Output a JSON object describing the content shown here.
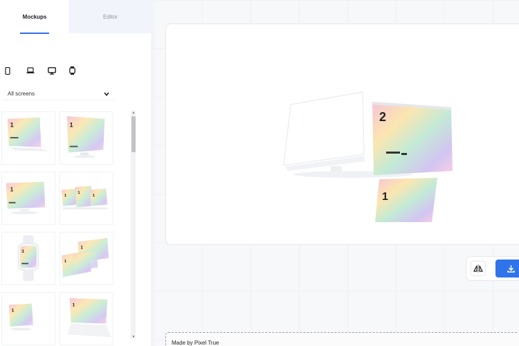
{
  "sidebar": {
    "tabs": [
      {
        "label": "Mockups",
        "active": true
      },
      {
        "label": "Editor",
        "active": false
      }
    ],
    "device_filters": [
      {
        "icon": "phone-icon"
      },
      {
        "icon": "laptop-icon"
      },
      {
        "icon": "desktop-icon"
      },
      {
        "icon": "watch-icon"
      }
    ],
    "dropdown": {
      "selected": "All screens"
    },
    "thumbnails": [
      {
        "kind": "tilted-screen-left"
      },
      {
        "kind": "desktop-monitor"
      },
      {
        "kind": "wide-monitor"
      },
      {
        "kind": "triple-laptops"
      },
      {
        "kind": "smartwatch"
      },
      {
        "kind": "stacked-screens"
      },
      {
        "kind": "small-monitor"
      },
      {
        "kind": "laptop-flat"
      }
    ]
  },
  "canvas": {
    "preview_numbers": [
      "2",
      "1"
    ]
  },
  "toolbar": {
    "flip_icon": "flip-horizontal-icon",
    "download_icon": "download-icon"
  },
  "footer": {
    "label": "Made by Pixel True"
  },
  "colors": {
    "accent": "#2f74ea",
    "tab_underline": "#2f6fed"
  }
}
